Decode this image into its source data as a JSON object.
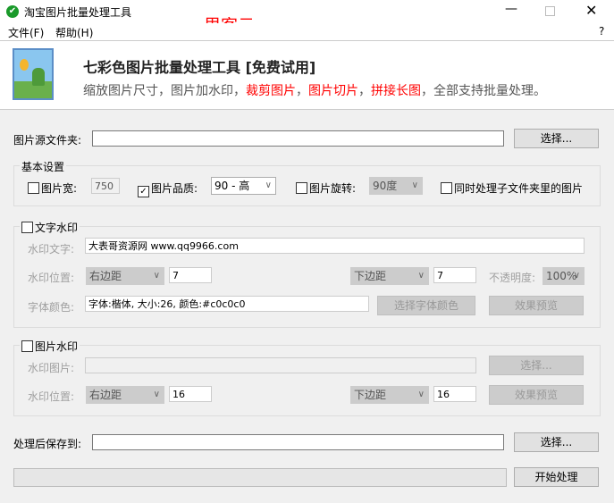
{
  "window": {
    "title": "淘宝图片批量处理工具",
    "overlay": "里客云"
  },
  "menu": {
    "file": "文件(F)",
    "help": "帮助(H)",
    "question": "?"
  },
  "header": {
    "title": "七彩色图片批量处理工具 [免费试用]",
    "desc": [
      {
        "t": "缩放图片尺寸，图片加水印，",
        "red": false
      },
      {
        "t": "裁剪图片",
        "red": true
      },
      {
        "t": "，",
        "red": false
      },
      {
        "t": "图片切片",
        "red": true
      },
      {
        "t": "，",
        "red": false
      },
      {
        "t": "拼接长图",
        "red": true
      },
      {
        "t": "，全部支持批量处理。",
        "red": false
      }
    ]
  },
  "source": {
    "label": "图片源文件夹:",
    "value": "",
    "button": "选择..."
  },
  "basic": {
    "title": "基本设置",
    "width_label": "图片宽:",
    "width_value": "750",
    "quality_label": "图片品质:",
    "quality_value": "90 - 高",
    "rotate_label": "图片旋转:",
    "rotate_value": "90度",
    "subfolder_label": "同时处理子文件夹里的图片"
  },
  "text_wm": {
    "title": "文字水印",
    "text_label": "水印文字:",
    "text_value": "大表哥资源网 www.qq9966.com",
    "pos_label": "水印位置:",
    "hpos": "右边距",
    "hval": "7",
    "vpos": "下边距",
    "vval": "7",
    "opacity_label": "不透明度:",
    "opacity": "100%",
    "font_label": "字体颜色:",
    "font_value": "字体:楷体, 大小:26, 颜色:#c0c0c0",
    "font_button": "选择字体颜色",
    "preview_button": "效果预览"
  },
  "img_wm": {
    "title": "图片水印",
    "img_label": "水印图片:",
    "img_value": "",
    "select_button": "选择...",
    "pos_label": "水印位置:",
    "hpos": "右边距",
    "hval": "16",
    "vpos": "下边距",
    "vval": "16",
    "preview_button": "效果预览"
  },
  "output": {
    "label": "处理后保存到:",
    "value": "",
    "button": "选择...",
    "start": "开始处理",
    "progress": 0
  }
}
